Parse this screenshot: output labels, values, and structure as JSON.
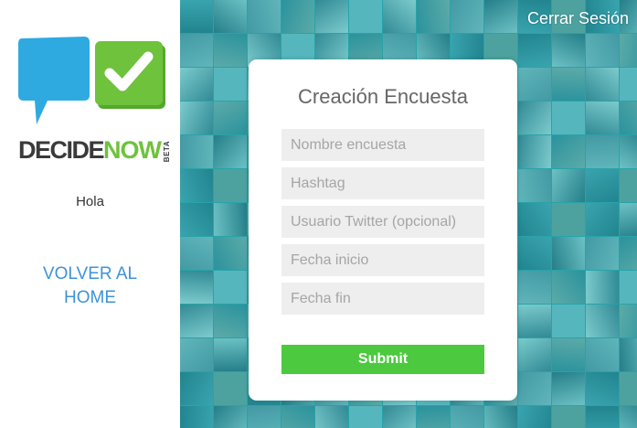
{
  "brand": {
    "name_part1": "DECIDE",
    "name_part2": "NOW",
    "badge": "BETA",
    "colors": {
      "bubble_blue": "#2eaae1",
      "check_green": "#6fc23c",
      "text_dark": "#3a3a3a"
    }
  },
  "sidebar": {
    "greeting": "Hola",
    "home_link_line1": "VOLVER AL",
    "home_link_line2": "HOME"
  },
  "header": {
    "logout_label": "Cerrar Sesión"
  },
  "form": {
    "title": "Creación Encuesta",
    "fields": [
      {
        "placeholder": "Nombre encuesta",
        "value": ""
      },
      {
        "placeholder": "Hashtag",
        "value": ""
      },
      {
        "placeholder": "Usuario Twitter (opcional)",
        "value": ""
      },
      {
        "placeholder": "Fecha inicio",
        "value": ""
      },
      {
        "placeholder": "Fecha fin",
        "value": ""
      }
    ],
    "submit_label": "Submit"
  },
  "theme": {
    "link_color": "#3e93d6",
    "submit_color": "#4cc93f",
    "mosaic_tint": "#26bec8",
    "field_bg": "#eeeeee"
  }
}
